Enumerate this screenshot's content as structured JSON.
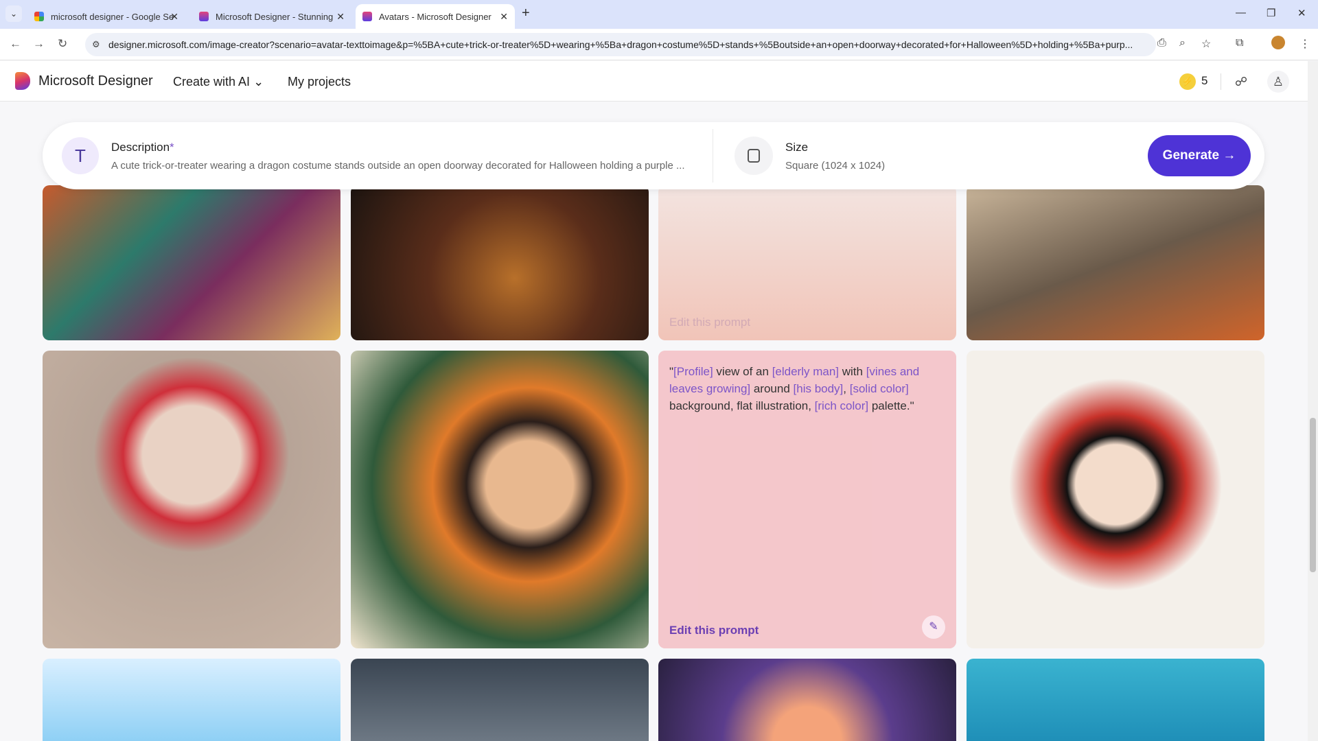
{
  "browser": {
    "tabs": [
      {
        "title": "microsoft designer - Google Se",
        "favicon": "google-icon"
      },
      {
        "title": "Microsoft Designer - Stunning",
        "favicon": "designer-icon"
      },
      {
        "title": "Avatars - Microsoft Designer",
        "favicon": "designer-icon",
        "active": true
      }
    ],
    "url": "designer.microsoft.com/image-creator?scenario=avatar-texttoimage&p=%5BA+cute+trick-or-treater%5D+wearing+%5Ba+dragon+costume%5D+stands+%5Boutside+an+open+doorway+decorated+for+Halloween%5D+holding+%5Ba+purp..."
  },
  "header": {
    "brand": "Microsoft Designer",
    "nav": [
      "Create with AI",
      "My projects"
    ],
    "credits": "5"
  },
  "prompt": {
    "description_label": "Description",
    "required_mark": "*",
    "description": "A cute trick-or-treater wearing a dragon costume stands outside an open doorway decorated for Halloween holding a purple ...",
    "size_label": "Size",
    "size_value": "Square (1024 x 1024)",
    "generate": "Generate"
  },
  "hover_prompt": {
    "parts": [
      {
        "t": "\"",
        "v": false
      },
      {
        "t": "[Profile]",
        "v": true
      },
      {
        "t": " view of an ",
        "v": false
      },
      {
        "t": "[elderly man]",
        "v": true
      },
      {
        "t": " with ",
        "v": false
      },
      {
        "t": "[vines and leaves growing]",
        "v": true
      },
      {
        "t": " around ",
        "v": false
      },
      {
        "t": "[his body]",
        "v": true
      },
      {
        "t": ", ",
        "v": false
      },
      {
        "t": "[solid color]",
        "v": true
      },
      {
        "t": " background, flat illustration, ",
        "v": false
      },
      {
        "t": "[rich color]",
        "v": true
      },
      {
        "t": " palette.\"",
        "v": false
      }
    ],
    "edit_label": "Edit this prompt"
  },
  "colors": {
    "accent": "#4e33d6",
    "variable": "#7c55c8"
  }
}
